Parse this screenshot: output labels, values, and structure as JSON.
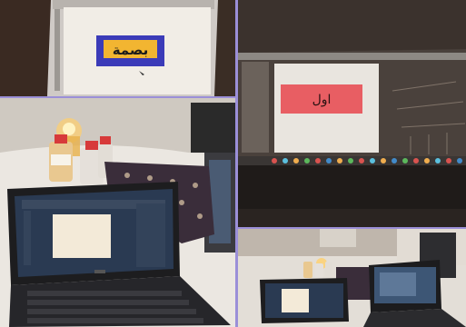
{
  "collage": {
    "panels": [
      {
        "label": "بصمة"
      },
      {},
      {
        "label": "اول"
      },
      {}
    ]
  },
  "colors": {
    "divider": "#9b8fd8",
    "bassma_box": "#f2b531",
    "bassma_border": "#3b3bb8",
    "awwal_box": "#e85e63",
    "screen_canvas": "#f3ead8"
  }
}
